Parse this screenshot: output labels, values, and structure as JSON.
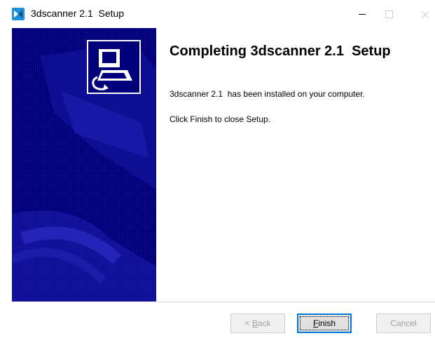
{
  "window": {
    "title": "3dscanner 2.1  Setup",
    "controls": {
      "minimize_icon": "minimize-icon",
      "maximize_icon": "maximize-icon",
      "close_icon": "close-icon"
    }
  },
  "wizard": {
    "heading": "Completing 3dscanner 2.1  Setup",
    "installed_message": "3dscanner 2.1  has been installed on your computer.",
    "instruction": "Click Finish to close Setup."
  },
  "buttons": {
    "back": {
      "pre": "< ",
      "accel": "B",
      "post": "ack",
      "enabled": false
    },
    "finish": {
      "accel": "F",
      "post": "inish",
      "enabled": true
    },
    "cancel": {
      "label": "Cancel",
      "enabled": false
    }
  },
  "colors": {
    "side_panel": "#01007a",
    "accent": "#0078d7"
  }
}
